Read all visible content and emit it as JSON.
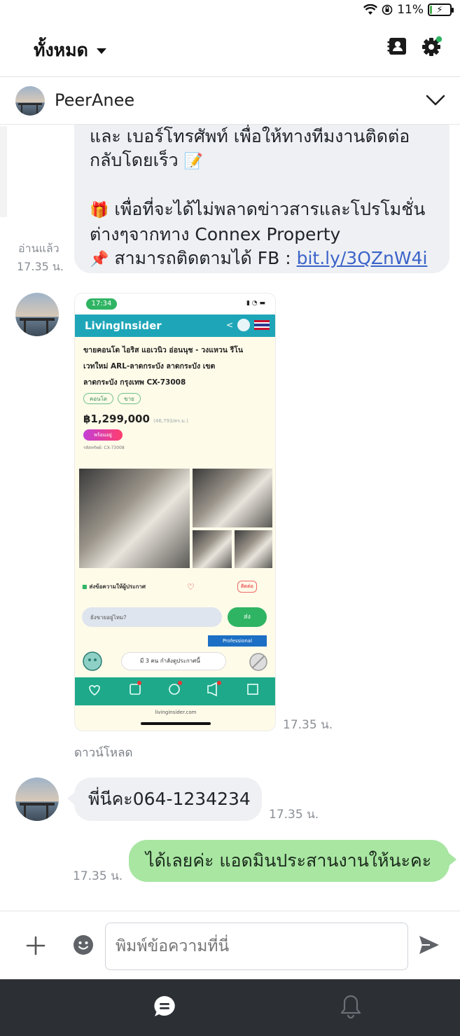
{
  "status_bar": {
    "battery_text": "11%",
    "battery_level": 0.11,
    "icons": [
      "wifi-icon",
      "orientation-lock-icon",
      "battery-charging-icon"
    ]
  },
  "header": {
    "filter_label": "ทั้งหมด",
    "icons": [
      "contacts-icon",
      "settings-icon"
    ],
    "settings_badge_color": "#2fb463"
  },
  "chat": {
    "contact_name": "PeerAnee"
  },
  "messages": {
    "promo": {
      "lines": [
        "และ เบอร์โทรศัพท์ เพื่อให้ทางทีมงานติดต่อ",
        "กลับโดยเร็ว",
        "เพื่อที่จะได้ไม่พลาดข่าวสารและโปรโมชั่น",
        "ต่างๆจากทาง Connex Property",
        "สามารถติดตามได้ FB : "
      ],
      "link_text": "bit.ly/3QZnW4i",
      "emojis": [
        "📝",
        "🎁",
        "📌"
      ],
      "read_label": "อ่านแล้ว",
      "time": "17.35 น."
    },
    "image_message": {
      "time": "17.35 น.",
      "download_label": "ดาวน์โหลด",
      "screenshot": {
        "phone_time": "17:34",
        "brand": "LivingInsider",
        "title_lines": [
          "ขายคอนโด ไอริส แอเวนิว อ่อนนุช - วงแหวน รีโน",
          "เวทใหม่ ARL-ลาดกระบัง ลาดกระบัง เขต",
          "ลาดกระบัง กรุงเทพ CX-73008"
        ],
        "chips": [
          "คอนโด",
          "ขาย"
        ],
        "price": "฿1,299,000",
        "price_note": "(46,793/ตร.ม.)",
        "pill": "พร้อมอยู่",
        "fine_print": "รหัสทรัพย์: CX-73008",
        "action_label": "ส่งข้อความให้ผู้ประกาศ",
        "contact_button": "ติดต่อ",
        "input_placeholder": "ยังขายอยู่ไหม?",
        "send_label": "ส่ง",
        "pro_label": "Professional",
        "toast": "มี 3 คน กำลังดูประกาศนี้",
        "url": "livinginsider.com"
      }
    },
    "phone_message": {
      "text": "พี่นีคะ064-1234234",
      "time": "17.35 น."
    },
    "outgoing": {
      "text": "ได้เลยค่ะ แอดมินประสานงานให้นะคะ",
      "time": "17.35 น."
    }
  },
  "composer": {
    "placeholder": "พิมพ์ข้อความที่นี่",
    "icons": [
      "plus-icon",
      "emoji-icon",
      "send-icon"
    ]
  },
  "bottom_nav": {
    "items": [
      "chat-icon",
      "bell-icon"
    ]
  }
}
